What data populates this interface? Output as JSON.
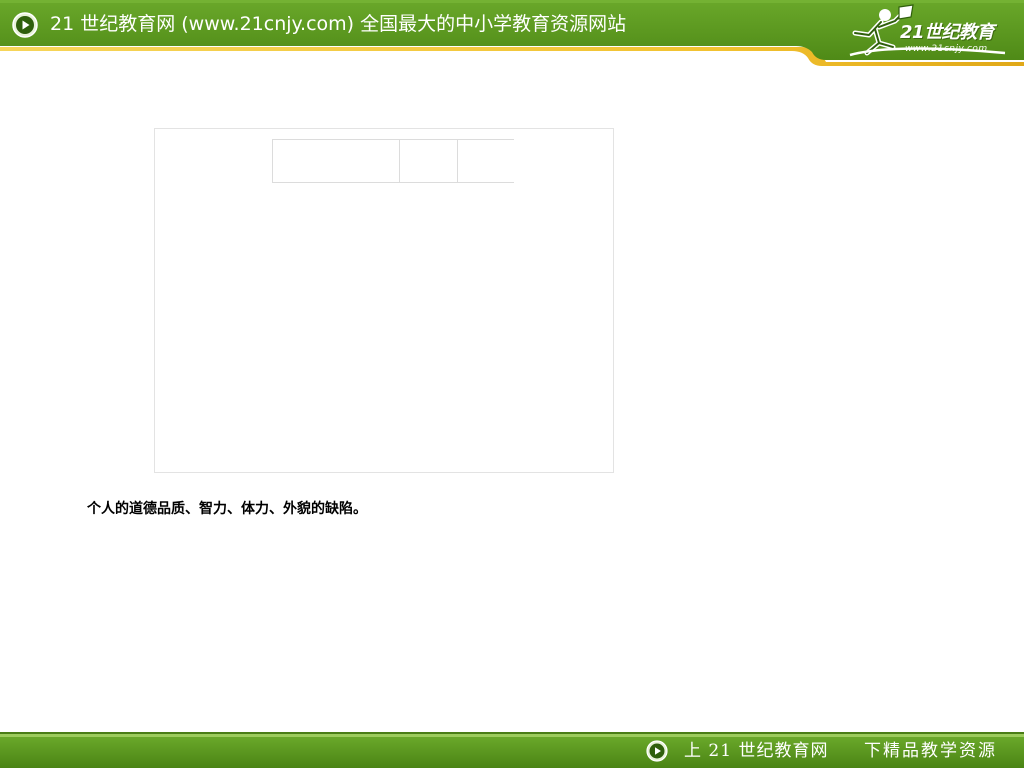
{
  "header": {
    "title": "21 世纪教育网 (www.21cnjy.com)  全国最大的中小学教育资源网站",
    "logo_text": "21世纪教育",
    "logo_url": "www.21cnjy.com",
    "play_icon": "play-circle-icon"
  },
  "main": {
    "caption": "个人的道德品质、智力、体力、外貌的缺陷。"
  },
  "footer": {
    "left_text": "上 21 世纪教育网",
    "right_text": "下精品教学资源",
    "play_icon": "play-circle-icon"
  },
  "colors": {
    "header_green": "#5e9a1f",
    "header_dark": "#47800f",
    "accent_yellow": "#f2c230",
    "footer_green": "#5d9620"
  }
}
